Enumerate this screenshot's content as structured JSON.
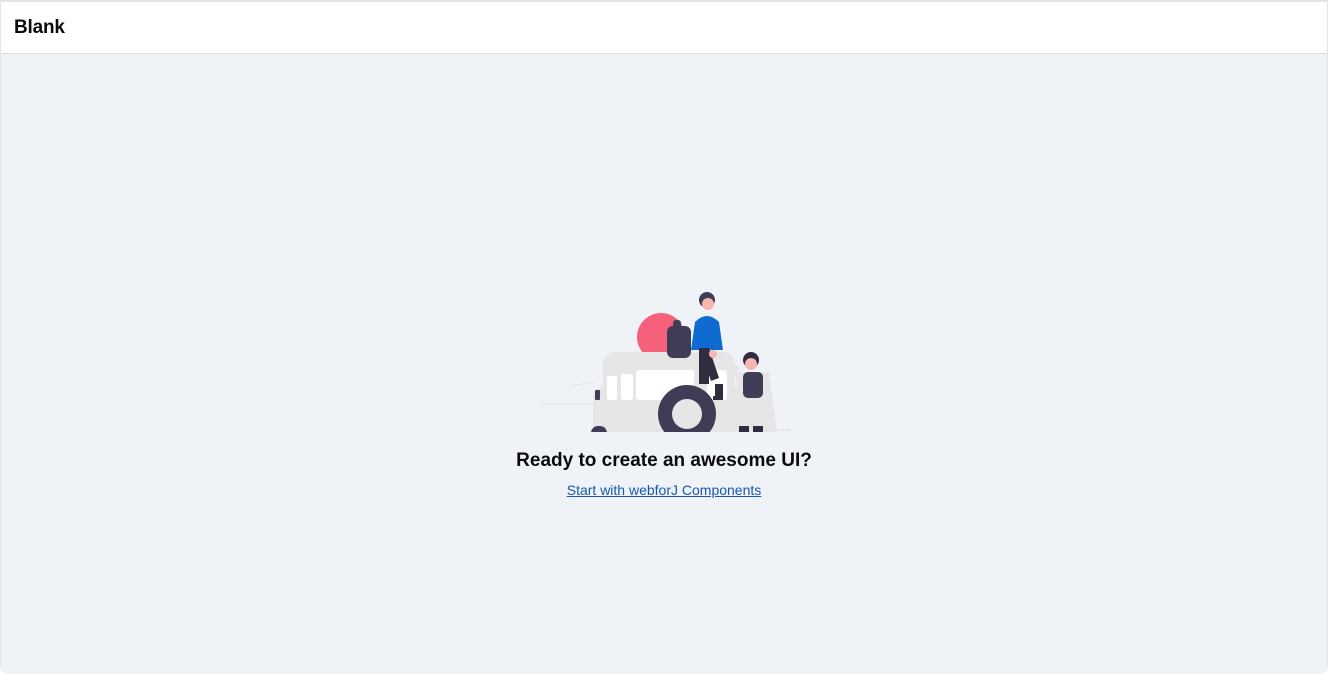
{
  "header": {
    "title": "Blank"
  },
  "empty_state": {
    "illustration": "car-with-people-illustration",
    "headline": "Ready to create an awesome UI?",
    "link_label": "Start with webforJ Components"
  },
  "colors": {
    "accent_link": "#1559b0",
    "sun": "#f5607a",
    "jacket": "#0f6bd1",
    "dark": "#3f3d56",
    "car_body": "#e6e6e6",
    "background": "#eff3f8"
  }
}
